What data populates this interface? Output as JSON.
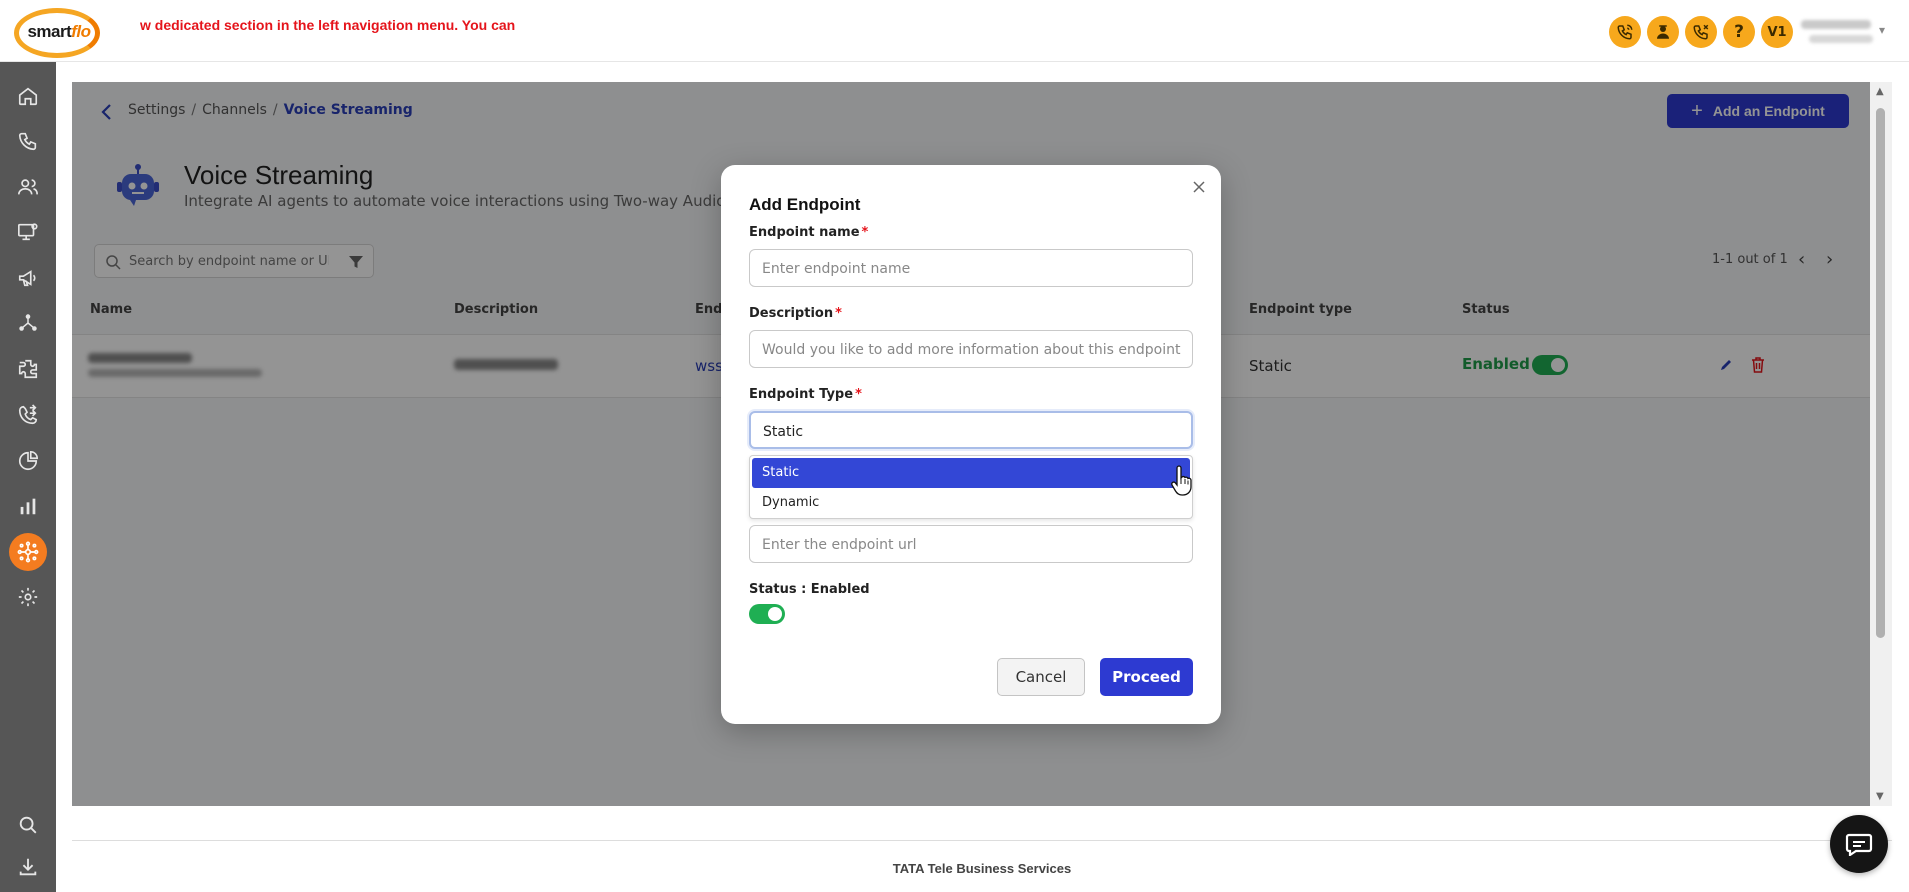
{
  "brand": {
    "logo_text_main": "smart",
    "logo_text_accent": "flo",
    "marquee": "w dedicated section in the left navigation menu. You can",
    "user_initials": "V1"
  },
  "colors": {
    "primary": "#2d3ad1",
    "accent_orange": "#f47c20",
    "success": "#1faf53",
    "danger": "#e5141b"
  },
  "sidebar": {
    "items": [
      {
        "icon": "home-icon"
      },
      {
        "icon": "phone-icon"
      },
      {
        "icon": "users-icon"
      },
      {
        "icon": "monitor-settings-icon"
      },
      {
        "icon": "megaphone-icon"
      },
      {
        "icon": "network-icon"
      },
      {
        "icon": "plugin-icon"
      },
      {
        "icon": "call-transfer-icon"
      },
      {
        "icon": "pie-chart-icon"
      },
      {
        "icon": "bar-chart-icon"
      },
      {
        "icon": "integrations-icon",
        "active": true
      },
      {
        "icon": "gear-icon"
      }
    ],
    "bottom": [
      {
        "icon": "search-icon"
      },
      {
        "icon": "download-icon"
      }
    ]
  },
  "breadcrumb": {
    "items": [
      "Settings",
      "Channels"
    ],
    "separator": "/",
    "current": "Voice Streaming"
  },
  "header": {
    "title": "Voice Streaming",
    "subtitle": "Integrate AI agents to automate voice interactions using Two-way Audio Stre",
    "add_button": "Add an Endpoint",
    "add_button_icon": "+"
  },
  "search": {
    "placeholder": "Search by endpoint name or URL"
  },
  "pagination": {
    "text": "1-1 out of 1",
    "prev": "‹",
    "next": "›"
  },
  "table": {
    "headers": [
      "Name",
      "Description",
      "Endp",
      "Endpoint type",
      "Status"
    ],
    "rows": [
      {
        "endpoint_prefix": "wss",
        "endpoint_type": "Static",
        "status": "Enabled"
      }
    ]
  },
  "modal": {
    "title": "Add Endpoint",
    "endpoint_name_label": "Endpoint name",
    "endpoint_name_placeholder": "Enter endpoint name",
    "description_label": "Description",
    "description_placeholder": "Would you like to add more information about this endpoint",
    "endpoint_type_label": "Endpoint Type",
    "endpoint_type_value": "Static",
    "endpoint_type_options": [
      "Static",
      "Dynamic"
    ],
    "url_placeholder": "Enter the endpoint url",
    "status_label": "Status : Enabled",
    "required_marker": "*",
    "cancel": "Cancel",
    "proceed": "Proceed"
  },
  "footer": {
    "text": "TATA Tele Business Services"
  }
}
